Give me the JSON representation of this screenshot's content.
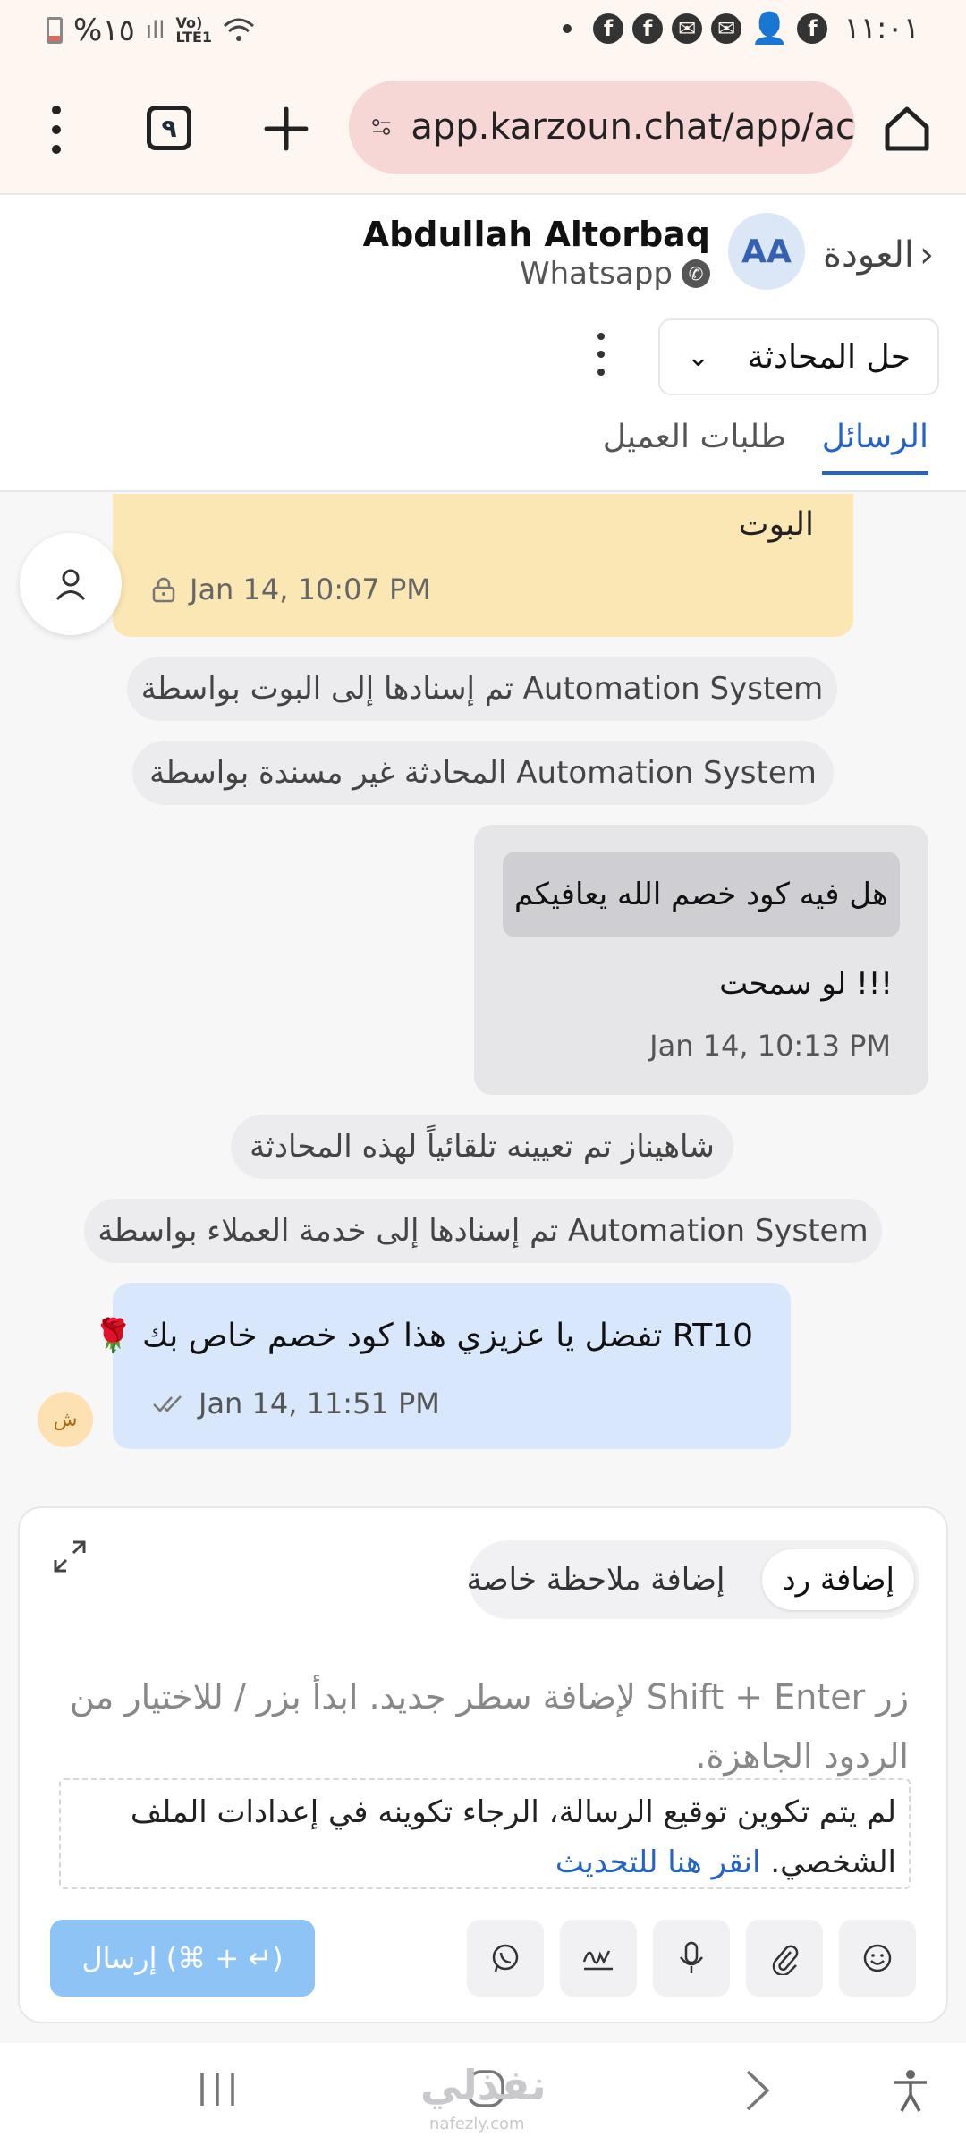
{
  "status_bar": {
    "battery_text": "%١٥",
    "network_text": "Vo) LTE1",
    "time": "١١:٠١"
  },
  "browser": {
    "url": "app.karzoun.chat/app/ac",
    "tab_count": "٩"
  },
  "header": {
    "back_label": "العودة",
    "avatar_initials": "AA",
    "contact_name": "Abdullah Altorbaq",
    "channel": "Whatsapp",
    "resolve_label": "حل المحادثة",
    "tabs": [
      {
        "label": "الرسائل",
        "active": true
      },
      {
        "label": "طلبات العميل",
        "active": false
      }
    ]
  },
  "messages": {
    "bot_message_text": "البوت",
    "bot_message_time": "Jan 14, 10:07 PM",
    "system_1": "تم إسنادها إلى البوت بواسطة Automation System",
    "system_2": "المحادثة غير مسندة بواسطة Automation System",
    "incoming_quote": "هل فيه كود خصم الله يعافيكم",
    "incoming_text": "لو سمحت !!!",
    "incoming_time": "Jan 14, 10:13 PM",
    "system_3": "شاهيناز تم تعيينه تلقائياً لهذه المحادثة",
    "system_4": "تم إسنادها إلى خدمة العملاء بواسطة Automation System",
    "outgoing_text": "RT10 تفضل يا عزيزي هذا كود خصم خاص بك",
    "outgoing_emoji": "🌹",
    "outgoing_time": "Jan 14, 11:51 PM",
    "agent_avatar_initial": "ش"
  },
  "composer": {
    "mode_reply": "إضافة رد",
    "mode_note": "إضافة ملاحظة خاصة",
    "placeholder": "زر Shift + Enter لإضافة سطر جديد. ابدأ بزر / للاختيار من الردود الجاهزة.",
    "signature_note": "لم يتم تكوين توقيع الرسالة، الرجاء تكوينه في إعدادات الملف الشخصي.",
    "signature_link": "انقر هنا للتحديث",
    "send_label": "إرسال (⌘ + ↵)"
  },
  "watermark": {
    "text": "نفذلي",
    "sub": "nafezly.com"
  },
  "colors": {
    "accent": "#2563c9",
    "bot_bubble": "#fbe7b3",
    "outgoing_bubble": "#d8e7fb",
    "send_button": "#8ec3f5"
  }
}
